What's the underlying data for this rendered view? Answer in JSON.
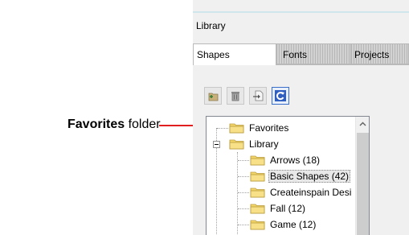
{
  "annotation": {
    "bold": "Favorites",
    "rest": " folder",
    "arrow_color": "#e02020"
  },
  "panel": {
    "title": "Library",
    "tabs": [
      {
        "label": "Shapes",
        "active": true
      },
      {
        "label": "Fonts",
        "active": false
      },
      {
        "label": "Projects",
        "active": false
      }
    ]
  },
  "toolbar": {
    "buttons": [
      {
        "icon": "new-folder-icon"
      },
      {
        "icon": "trash-icon"
      },
      {
        "icon": "import-icon"
      },
      {
        "icon": "refresh-icon"
      }
    ]
  },
  "tree": {
    "items": [
      {
        "label": "Favorites",
        "level": 0
      },
      {
        "label": "Library",
        "level": 0,
        "expanded": true
      },
      {
        "label": "Arrows (18)",
        "level": 1
      },
      {
        "label": "Basic Shapes (42)",
        "level": 1,
        "selected": true
      },
      {
        "label": "Createinspain Desi",
        "level": 1
      },
      {
        "label": "Fall (12)",
        "level": 1
      },
      {
        "label": "Game (12)",
        "level": 1
      }
    ]
  },
  "colors": {
    "folder": "#f5d66b",
    "refresh_accent": "#2f5fbf"
  }
}
